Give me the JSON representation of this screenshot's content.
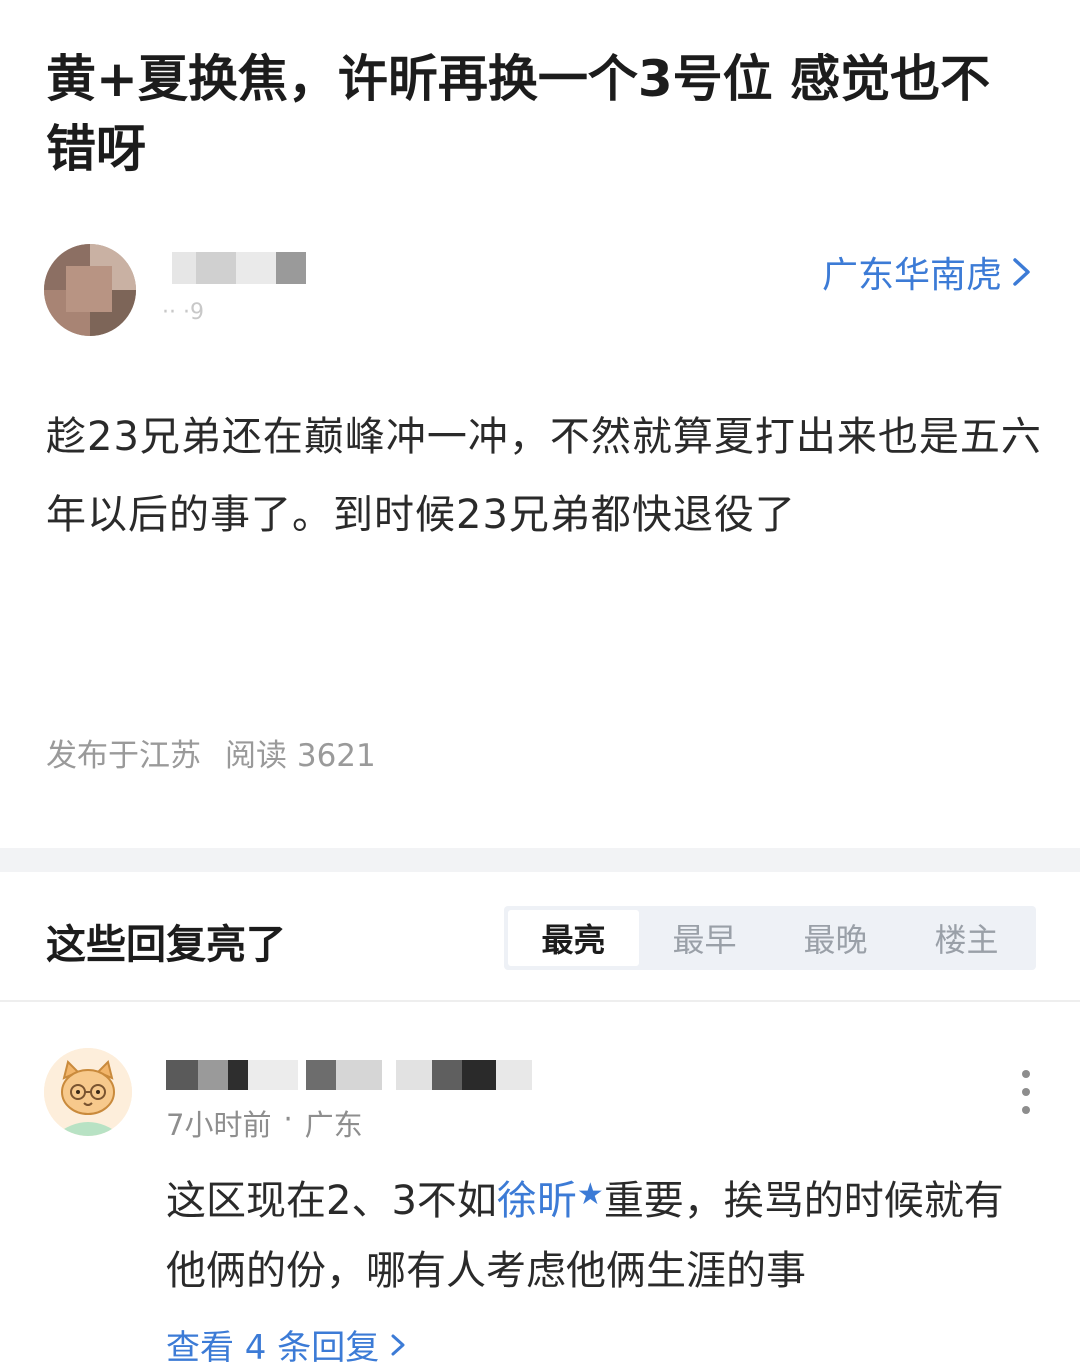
{
  "post": {
    "title": "黄+夏换焦，许昕再换一个3号位 感觉也不错呀",
    "forum_link": "广东华南虎",
    "author_meta": "·· ·9",
    "body": "趁23兄弟还在巅峰冲一冲，不然就算夏打出来也是五六年以后的事了。到时候23兄弟都快退役了",
    "location": "发布于江苏",
    "reads": "阅读 3621"
  },
  "replies": {
    "title": "这些回复亮了",
    "sort_tabs": [
      "最亮",
      "最早",
      "最晚",
      "楼主"
    ],
    "active_tab": "最亮"
  },
  "comment": {
    "time": "7小时前",
    "dot": "·",
    "location": "广东",
    "text_before": "这区现在2、3不如",
    "mention": "徐昕",
    "mention_star": "★",
    "text_after": "重要，挨骂的时候就有他俩的份，哪有人考虑他俩生涯的事",
    "view_replies": "查看 4 条回复"
  },
  "colors": {
    "link_blue": "#3c7bd6",
    "muted_gray": "#9a9a9a",
    "section_bg": "#f2f3f5"
  }
}
